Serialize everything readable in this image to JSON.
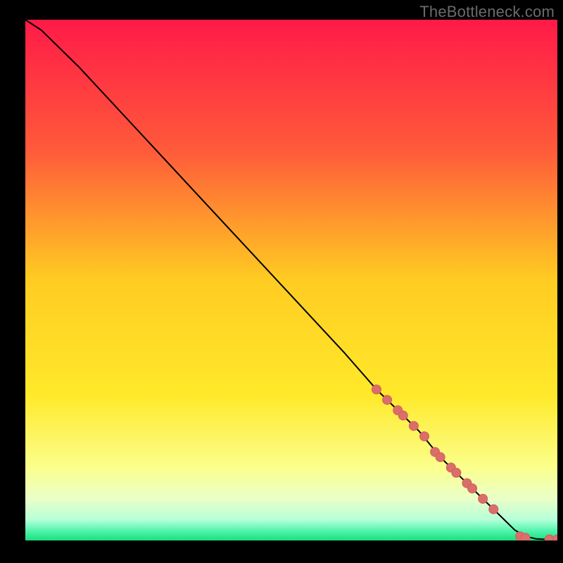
{
  "watermark": "TheBottleneck.com",
  "colors": {
    "gradient_stops": [
      {
        "pct": 0,
        "color": "#ff1a48"
      },
      {
        "pct": 25,
        "color": "#ff5a3a"
      },
      {
        "pct": 50,
        "color": "#ffcc22"
      },
      {
        "pct": 72,
        "color": "#ffe92a"
      },
      {
        "pct": 86,
        "color": "#fbff8c"
      },
      {
        "pct": 92,
        "color": "#eaffc8"
      },
      {
        "pct": 96,
        "color": "#b6ffd8"
      },
      {
        "pct": 98,
        "color": "#58f5b0"
      },
      {
        "pct": 100,
        "color": "#16e07e"
      }
    ],
    "line": "#000000",
    "marker_fill": "#da6e6a",
    "marker_stroke": "#d45e5a"
  },
  "chart_data": {
    "type": "line",
    "xlim": [
      0,
      100
    ],
    "ylim": [
      0,
      100
    ],
    "title": "",
    "xlabel": "",
    "ylabel": "",
    "series": [
      {
        "name": "curve",
        "x": [
          0,
          3,
          6,
          10,
          20,
          30,
          40,
          50,
          60,
          66,
          70,
          74,
          78,
          82,
          85,
          88,
          90,
          92,
          94,
          96,
          98,
          100
        ],
        "y": [
          100,
          98,
          95,
          91,
          80,
          69,
          58,
          47,
          36,
          29,
          25,
          21,
          16,
          12,
          9,
          6,
          4,
          2,
          0.8,
          0.3,
          0.2,
          0.2
        ]
      }
    ],
    "markers": {
      "name": "highlighted-range",
      "x": [
        66,
        68,
        70,
        71,
        73,
        75,
        77,
        78,
        80,
        81,
        83,
        84,
        86,
        88,
        93,
        94,
        98.5,
        100
      ],
      "y": [
        29,
        27,
        25,
        24,
        22,
        20,
        17,
        16,
        14,
        13,
        11,
        10,
        8,
        6,
        0.8,
        0.5,
        0.2,
        0.2
      ],
      "r": 6.5
    }
  }
}
